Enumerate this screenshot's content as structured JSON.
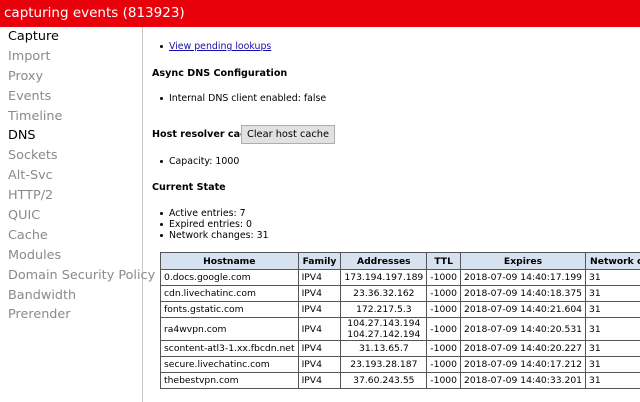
{
  "window": {
    "title": "capturing events (813923)"
  },
  "sidebar": {
    "items": [
      {
        "label": "Capture",
        "active": true
      },
      {
        "label": "Import",
        "active": false
      },
      {
        "label": "Proxy",
        "active": false
      },
      {
        "label": "Events",
        "active": false
      },
      {
        "label": "Timeline",
        "active": false
      },
      {
        "label": "DNS",
        "active": true
      },
      {
        "label": "Sockets",
        "active": false
      },
      {
        "label": "Alt-Svc",
        "active": false
      },
      {
        "label": "HTTP/2",
        "active": false
      },
      {
        "label": "QUIC",
        "active": false
      },
      {
        "label": "Cache",
        "active": false
      },
      {
        "label": "Modules",
        "active": false
      },
      {
        "label": "Domain Security Policy",
        "active": false
      },
      {
        "label": "Bandwidth",
        "active": false
      },
      {
        "label": "Prerender",
        "active": false
      }
    ]
  },
  "main": {
    "pending_link": "View pending lookups",
    "async_heading": "Async DNS Configuration",
    "internal_dns": "Internal DNS client enabled: false",
    "resolver_heading": "Host resolver cache",
    "clear_button": "Clear host cache",
    "capacity": "Capacity: 1000",
    "state_heading": "Current State",
    "active_entries": "Active entries: 7",
    "expired_entries": "Expired entries: 0",
    "network_changes": "Network changes: 31"
  },
  "table": {
    "headers": [
      "Hostname",
      "Family",
      "Addresses",
      "TTL",
      "Expires",
      "Network changes"
    ],
    "rows": [
      {
        "hostname": "0.docs.google.com",
        "family": "IPV4",
        "addresses": [
          "173.194.197.189"
        ],
        "ttl": "-1000",
        "expires": "2018-07-09 14:40:17.199",
        "changes": "31"
      },
      {
        "hostname": "cdn.livechatinc.com",
        "family": "IPV4",
        "addresses": [
          "23.36.32.162"
        ],
        "ttl": "-1000",
        "expires": "2018-07-09 14:40:18.375",
        "changes": "31"
      },
      {
        "hostname": "fonts.gstatic.com",
        "family": "IPV4",
        "addresses": [
          "172.217.5.3"
        ],
        "ttl": "-1000",
        "expires": "2018-07-09 14:40:21.604",
        "changes": "31"
      },
      {
        "hostname": "ra4wvpn.com",
        "family": "IPV4",
        "addresses": [
          "104.27.143.194",
          "104.27.142.194"
        ],
        "ttl": "-1000",
        "expires": "2018-07-09 14:40:20.531",
        "changes": "31"
      },
      {
        "hostname": "scontent-atl3-1.xx.fbcdn.net",
        "family": "IPV4",
        "addresses": [
          "31.13.65.7"
        ],
        "ttl": "-1000",
        "expires": "2018-07-09 14:40:20.227",
        "changes": "31"
      },
      {
        "hostname": "secure.livechatinc.com",
        "family": "IPV4",
        "addresses": [
          "23.193.28.187"
        ],
        "ttl": "-1000",
        "expires": "2018-07-09 14:40:17.212",
        "changes": "31"
      },
      {
        "hostname": "thebestvpn.com",
        "family": "IPV4",
        "addresses": [
          "37.60.243.55"
        ],
        "ttl": "-1000",
        "expires": "2018-07-09 14:40:33.201",
        "changes": "31"
      }
    ]
  },
  "colors": {
    "titlebar": "#e8000b",
    "table_header": "#d6e2f0",
    "link": "#1a0dab"
  }
}
